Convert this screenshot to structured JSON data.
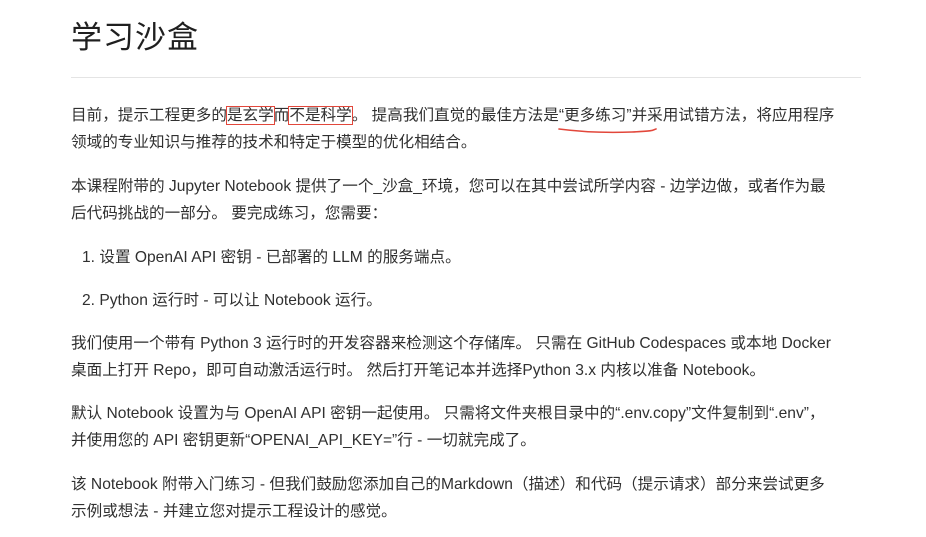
{
  "title": "学习沙盒",
  "p1": {
    "a": "目前，提示工程更多的",
    "box1": "是玄学",
    "b": "而",
    "box2": "不是科学",
    "c": "。 提高我们直觉的最佳方法是",
    "ul": "“更多练习”并采",
    "d": "用试错方法，将应用程序",
    "line2": "领域的专业知识与推荐的技术和特定于模型的优化相结合。"
  },
  "p2": {
    "line1": "本课程附带的 Jupyter Notebook 提供了一个_沙盒_环境，您可以在其中尝试所学内容 - 边学边做，或者作为最",
    "line2": "后代码挑战的一部分。 要完成练习，您需要："
  },
  "list": [
    {
      "num": "1.",
      "text": "设置 OpenAI API 密钥 - 已部署的 LLM 的服务端点。"
    },
    {
      "num": "2.",
      "text": "Python 运行时 - 可以让 Notebook 运行。"
    }
  ],
  "p3": {
    "line1": "我们使用一个带有 Python 3 运行时的开发容器来检测这个存储库。 只需在 GitHub Codespaces 或本地 Docker",
    "line2": "桌面上打开 Repo，即可自动激活运行时。 然后打开笔记本并选择Python 3.x 内核以准备 Notebook。"
  },
  "p4": {
    "line1": "默认 Notebook 设置为与 OpenAI API 密钥一起使用。 只需将文件夹根目录中的“.env.copy”文件复制到“.env”，",
    "line2": "并使用您的 API 密钥更新“OPENAI_API_KEY=”行 - 一切就完成了。"
  },
  "p5": {
    "line1": "该 Notebook 附带入门练习 - 但我们鼓励您添加自己的Markdown（描述）和代码（提示请求）部分来尝试更多",
    "line2": "示例或想法 - 并建立您对提示工程设计的感觉。"
  },
  "colors": {
    "annotation": "#e2473b",
    "text": "#303030",
    "rule": "#e4e4e4"
  }
}
